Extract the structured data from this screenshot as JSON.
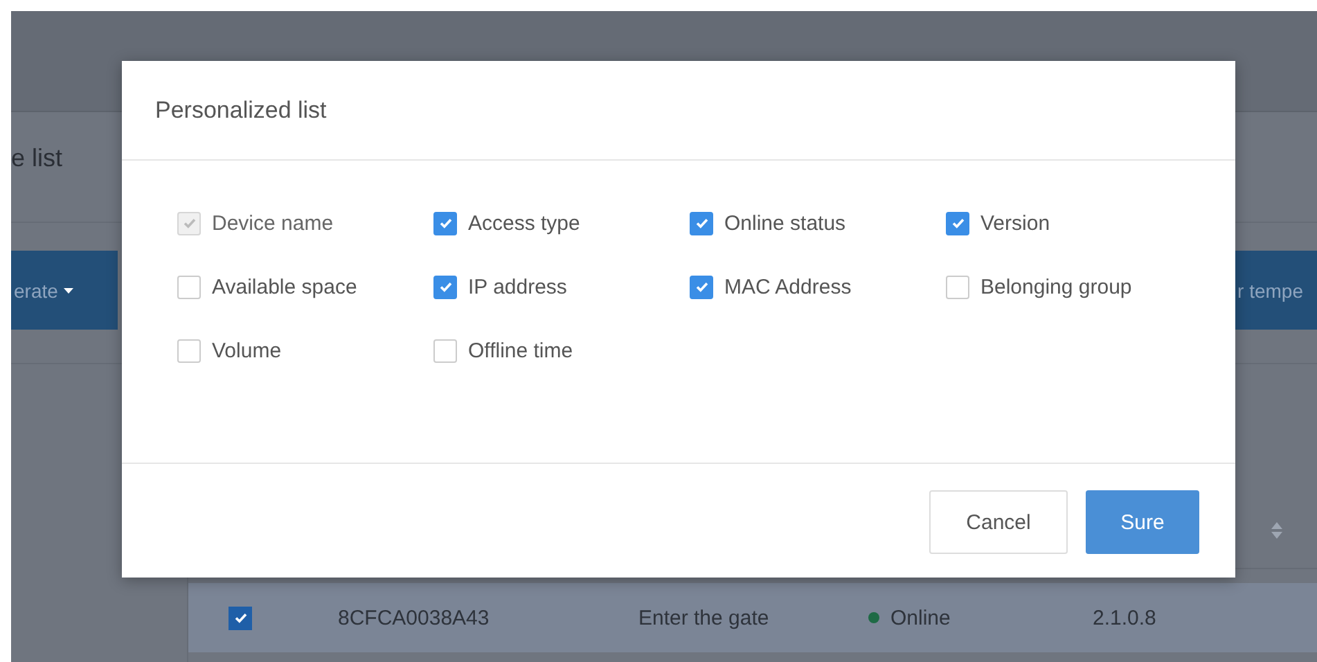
{
  "page": {
    "title_fragment": "e list",
    "toolbar_buttons": [
      {
        "label": "erate",
        "has_caret": true
      },
      {
        "label": "r tempe",
        "has_caret": false
      }
    ],
    "table": {
      "rows": [
        {
          "checked": true,
          "cells": [
            "8CFCA0038A43",
            "Enter the gate"
          ],
          "status": {
            "label": "Online",
            "color": "#1e6a45"
          },
          "version": "2.1.0.8"
        }
      ]
    }
  },
  "dialog": {
    "title": "Personalized list",
    "options": [
      {
        "label": "Device name",
        "checked": true,
        "disabled": true
      },
      {
        "label": "Access type",
        "checked": true,
        "disabled": false
      },
      {
        "label": "Online status",
        "checked": true,
        "disabled": false
      },
      {
        "label": "Version",
        "checked": true,
        "disabled": false
      },
      {
        "label": "Available space",
        "checked": false,
        "disabled": false
      },
      {
        "label": "IP address",
        "checked": true,
        "disabled": false
      },
      {
        "label": "MAC Address",
        "checked": true,
        "disabled": false
      },
      {
        "label": "Belonging group",
        "checked": false,
        "disabled": false
      },
      {
        "label": "Volume",
        "checked": false,
        "disabled": false
      },
      {
        "label": "Offline time",
        "checked": false,
        "disabled": false
      }
    ],
    "buttons": [
      {
        "label": "Cancel",
        "kind": "secondary"
      },
      {
        "label": "Sure",
        "kind": "primary"
      }
    ]
  }
}
